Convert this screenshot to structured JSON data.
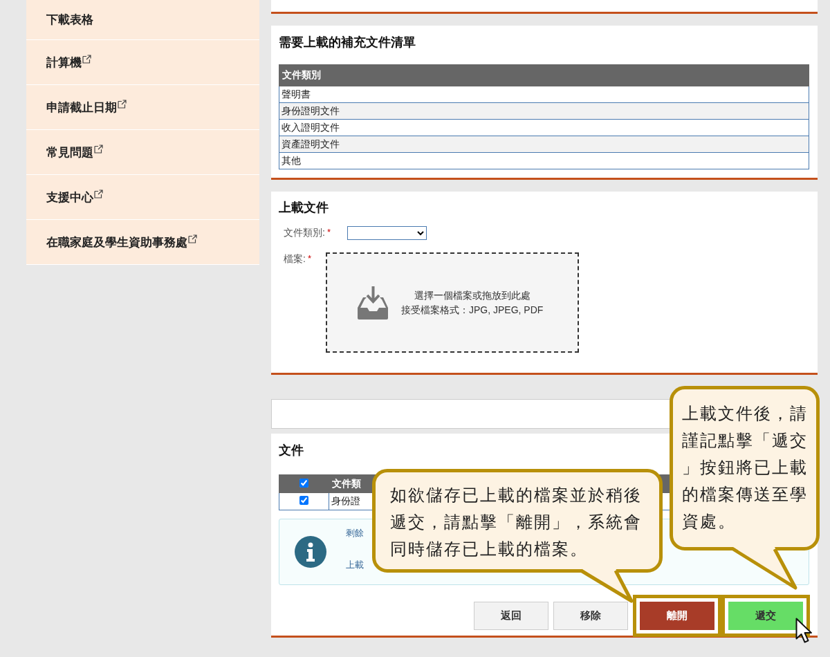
{
  "sidebar": {
    "items": [
      {
        "label": "下載表格",
        "external": false
      },
      {
        "label": "計算機",
        "external": true
      },
      {
        "label": "申請截止日期",
        "external": true
      },
      {
        "label": "常見問題",
        "external": true
      },
      {
        "label": "支援中心",
        "external": true
      },
      {
        "label": "在職家庭及學生資助事務處",
        "external": true
      }
    ]
  },
  "required_documents": {
    "title": "需要上載的補充文件清單",
    "columns": [
      "文件類別"
    ],
    "rows": [
      "聲明書",
      "身份證明文件",
      "收入證明文件",
      "資產證明文件",
      "其他"
    ]
  },
  "upload": {
    "title": "上載文件",
    "category_label": "文件類別:",
    "file_label": "檔案:",
    "required_mark": "*",
    "dropzone_lines": [
      "選擇一個檔案或拖放到此處",
      "接受檔案格式：JPG, JPEG, PDF"
    ]
  },
  "files": {
    "title": "文件",
    "header_checked": true,
    "columns": [
      "文件類"
    ],
    "rows": [
      {
        "checked": true,
        "category": "身份證"
      }
    ],
    "info_lines": [
      "剩餘",
      "上載"
    ],
    "buttons": [
      {
        "label": "返回",
        "kind": "default",
        "highlighted": false
      },
      {
        "label": "移除",
        "kind": "default",
        "highlighted": false
      },
      {
        "label": "離開",
        "kind": "danger",
        "highlighted": true
      },
      {
        "label": "遞交",
        "kind": "primary",
        "highlighted": true
      }
    ]
  },
  "callouts": [
    {
      "text": "如欲儲存已上載的檔案並於稍後遞交，請點擊「離開」，系統會同時儲存已上載的檔案。"
    },
    {
      "text": "上載文件後，請謹記點擊「遞交」按鈕將已上載的檔案傳送至學資處。"
    }
  ]
}
